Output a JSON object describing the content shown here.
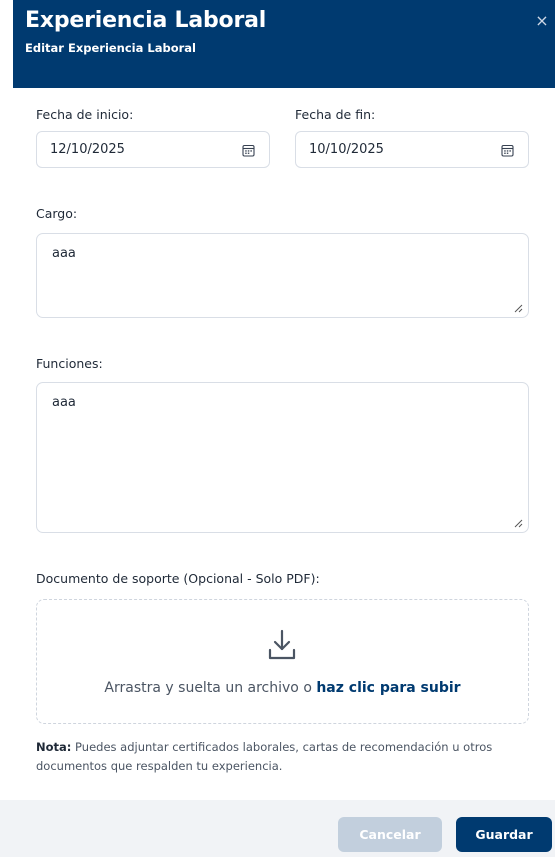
{
  "header": {
    "title": "Experiencia Laboral",
    "subtitle": "Editar Experiencia Laboral",
    "close_glyph": "×"
  },
  "form": {
    "start_date": {
      "label": "Fecha de inicio:",
      "value": "12/10/2025"
    },
    "end_date": {
      "label": "Fecha de fin:",
      "value": "10/10/2025"
    },
    "cargo": {
      "label": "Cargo:",
      "value": "aaa"
    },
    "funciones": {
      "label": "Funciones:",
      "value": "aaa"
    },
    "document": {
      "label": "Documento de soporte (Opcional - Solo PDF):",
      "drop_text": "Arrastra y suelta un archivo o ",
      "drop_link": "haz clic para subir"
    },
    "note": {
      "prefix": "Nota:",
      "text": " Puedes adjuntar certificados laborales, cartas de recomendación u otros documentos que respalden tu experiencia."
    }
  },
  "footer": {
    "cancel_label": "Cancelar",
    "save_label": "Guardar"
  },
  "colors": {
    "brand": "#003a70",
    "cancel_button": "#c2cfdd",
    "footer_bg": "#f1f3f6"
  },
  "icons": {
    "close": "close-icon",
    "calendar": "calendar-icon",
    "resize": "resize-grip-icon",
    "upload": "download-arrow-icon"
  }
}
